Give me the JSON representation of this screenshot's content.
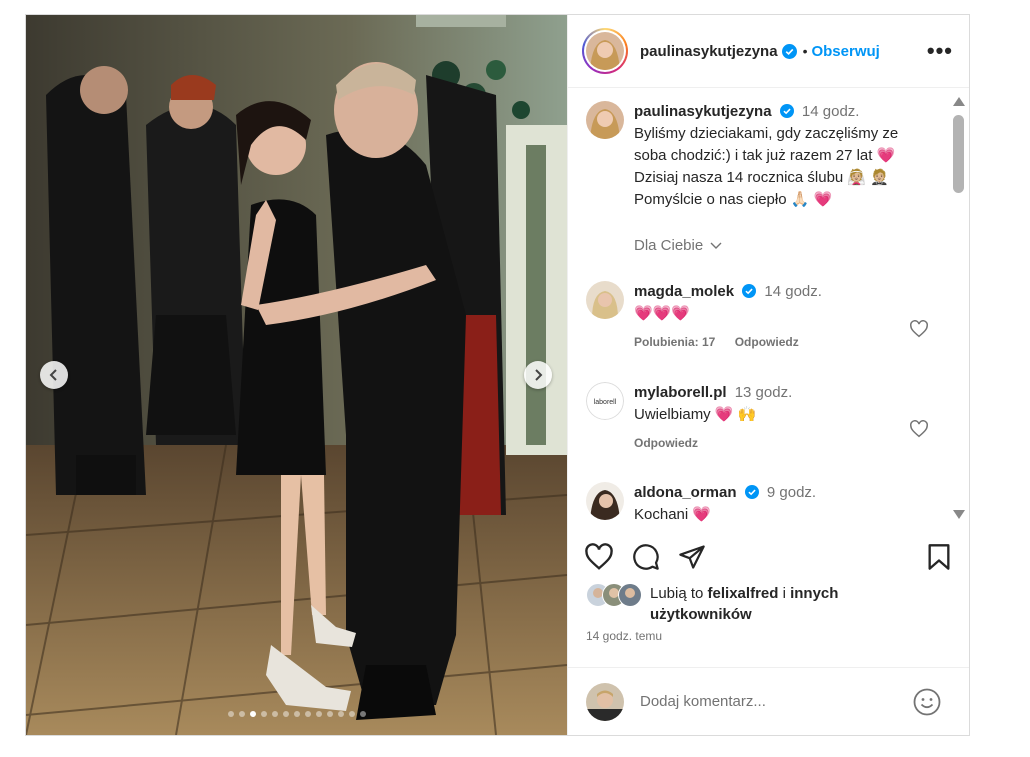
{
  "post": {
    "author": "paulinasykutjezyna",
    "follow_label": "Obserwuj",
    "more_label": "•••",
    "caption_time": "14 godz.",
    "caption_lines": [
      "Byliśmy dzieciakami, gdy zaczęliśmy ze",
      "soba chodzić:) i tak już razem 27 lat 💗",
      "Dzisiaj nasza 14 rocznica ślubu 👰🏼 🤵🏼",
      "Pomyślcie o nas ciepło 🙏🏻 💗"
    ],
    "for_you_label": "Dla Ciebie",
    "carousel_count": 13,
    "carousel_active": 3
  },
  "comments": [
    {
      "user": "magda_molek",
      "verified": true,
      "time": "14 godz.",
      "text": "💗💗💗",
      "likes_label": "Polubienia: 17",
      "reply_label": "Odpowiedz"
    },
    {
      "user": "mylaborell.pl",
      "verified": false,
      "time": "13 godz.",
      "text": "Uwielbiamy 💗 🙌",
      "reply_label": "Odpowiedz",
      "avatar_text": "laborell"
    },
    {
      "user": "aldona_orman",
      "verified": true,
      "time": "9 godz.",
      "text": "Kochani 💗"
    }
  ],
  "likes": {
    "prefix": "Lubią to ",
    "user": "felixalfred",
    "middle": " i ",
    "suffix": "innych",
    "line2": "użytkowników"
  },
  "posted_ago": "14 godz. temu",
  "add_comment": {
    "placeholder": "Dodaj komentarz..."
  },
  "colors": {
    "accent": "#0095f6",
    "verified": "#0095f6",
    "heart": "#e0245e"
  },
  "icons": [
    "chevron-left-icon",
    "chevron-right-icon",
    "more-icon",
    "verified-icon",
    "heart-icon",
    "comment-icon",
    "share-icon",
    "bookmark-icon",
    "emoji-icon",
    "chevron-down-icon"
  ]
}
